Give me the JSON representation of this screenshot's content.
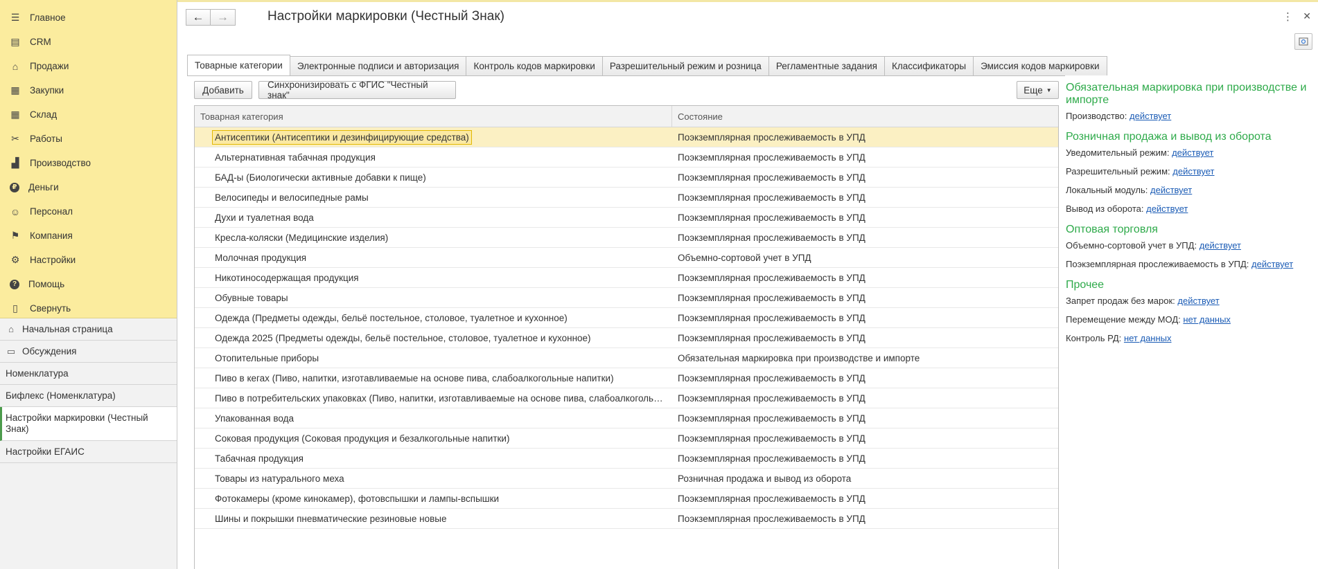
{
  "sidebar": {
    "sections": [
      {
        "label": "Главное",
        "icon": "menu-icon"
      },
      {
        "label": "CRM",
        "icon": "crm-icon"
      },
      {
        "label": "Продажи",
        "icon": "basket-icon"
      },
      {
        "label": "Закупки",
        "icon": "purchases-icon"
      },
      {
        "label": "Склад",
        "icon": "warehouse-icon"
      },
      {
        "label": "Работы",
        "icon": "tools-icon"
      },
      {
        "label": "Производство",
        "icon": "factory-icon"
      },
      {
        "label": "Деньги",
        "icon": "money-icon"
      },
      {
        "label": "Персонал",
        "icon": "staff-icon"
      },
      {
        "label": "Компания",
        "icon": "flag-icon"
      },
      {
        "label": "Настройки",
        "icon": "gear-icon"
      },
      {
        "label": "Помощь",
        "icon": "help-icon"
      },
      {
        "label": "Свернуть",
        "icon": "collapse-icon"
      }
    ],
    "open_windows": [
      {
        "label": "Начальная страница",
        "icon": "home-icon"
      },
      {
        "label": "Обсуждения",
        "icon": "chat-icon"
      },
      {
        "label": "Номенклатура"
      },
      {
        "label": "Бифлекс (Номенклатура)"
      },
      {
        "label": "Настройки маркировки (Честный Знак)"
      },
      {
        "label": "Настройки ЕГАИС"
      }
    ]
  },
  "header": {
    "title": "Настройки маркировки (Честный Знак)",
    "back_icon": "←",
    "forward_icon": "→",
    "more_icon": "⋮",
    "close_icon": "✕"
  },
  "tabs": [
    "Товарные категории",
    "Электронные подписи и авторизация",
    "Контроль кодов маркировки",
    "Разрешительный режим и розница",
    "Регламентные задания",
    "Классификаторы",
    "Эмиссия кодов маркировки"
  ],
  "toolbar": {
    "add_label": "Добавить",
    "sync_label": "Синхронизировать с ФГИС \"Честный знак\"",
    "more_label": "Еще"
  },
  "table": {
    "columns": [
      "Товарная категория",
      "Состояние"
    ],
    "rows": [
      [
        "Антисептики (Антисептики и дезинфицирующие средства)",
        "Поэкземплярная прослеживаемость в УПД"
      ],
      [
        "Альтернативная табачная продукция",
        "Поэкземплярная прослеживаемость в УПД"
      ],
      [
        "БАД-ы (Биологически активные добавки к пище)",
        "Поэкземплярная прослеживаемость в УПД"
      ],
      [
        "Велосипеды и велосипедные рамы",
        "Поэкземплярная прослеживаемость в УПД"
      ],
      [
        "Духи и туалетная вода",
        "Поэкземплярная прослеживаемость в УПД"
      ],
      [
        "Кресла-коляски (Медицинские изделия)",
        "Поэкземплярная прослеживаемость в УПД"
      ],
      [
        "Молочная продукция",
        "Объемно-сортовой учет в УПД"
      ],
      [
        "Никотиносодержащая продукция",
        "Поэкземплярная прослеживаемость в УПД"
      ],
      [
        "Обувные товары",
        "Поэкземплярная прослеживаемость в УПД"
      ],
      [
        "Одежда (Предметы одежды, бельё постельное, столовое, туалетное и кухонное)",
        "Поэкземплярная прослеживаемость в УПД"
      ],
      [
        "Одежда 2025 (Предметы одежды, бельё постельное, столовое, туалетное и кухонное)",
        "Поэкземплярная прослеживаемость в УПД"
      ],
      [
        "Отопительные приборы",
        "Обязательная маркировка при производстве и импорте"
      ],
      [
        "Пиво в кегах (Пиво, напитки, изготавливаемые на основе пива, слабоалкогольные напитки)",
        "Поэкземплярная прослеживаемость в УПД"
      ],
      [
        "Пиво в потребительских упаковках (Пиво, напитки, изготавливаемые на основе пива, слабоалкогольные ...",
        "Поэкземплярная прослеживаемость в УПД"
      ],
      [
        "Упакованная вода",
        "Поэкземплярная прослеживаемость в УПД"
      ],
      [
        "Соковая продукция (Соковая продукция и безалкогольные напитки)",
        "Поэкземплярная прослеживаемость в УПД"
      ],
      [
        "Табачная продукция",
        "Поэкземплярная прослеживаемость в УПД"
      ],
      [
        "Товары из натурального меха",
        "Розничная продажа и вывод из оборота"
      ],
      [
        "Фотокамеры (кроме кинокамер), фотовспышки и лампы-вспышки",
        "Поэкземплярная прослеживаемость в УПД"
      ],
      [
        "Шины и покрышки пневматические резиновые новые",
        "Поэкземплярная прослеживаемость в УПД"
      ]
    ]
  },
  "info": {
    "groups": [
      {
        "heading": "Обязательная маркировка при производстве и импорте",
        "lines": [
          {
            "label": "Производство:",
            "link": "действует"
          }
        ]
      },
      {
        "heading": "Розничная продажа и вывод из оборота",
        "lines": [
          {
            "label": "Уведомительный режим:",
            "link": "действует"
          },
          {
            "label": "Разрешительный режим:",
            "link": "действует"
          },
          {
            "label": "Локальный модуль:",
            "link": "действует"
          },
          {
            "label": "Вывод из оборота:",
            "link": "действует"
          }
        ]
      },
      {
        "heading": "Оптовая торговля",
        "lines": [
          {
            "label": "Объемно-сортовой учет в УПД:",
            "link": "действует"
          },
          {
            "label": "Поэкземплярная прослеживаемость в УПД:",
            "link": "действует"
          }
        ]
      },
      {
        "heading": "Прочее",
        "lines": [
          {
            "label": "Запрет продаж без марок:",
            "link": "действует"
          },
          {
            "label": "Перемещение между МОД:",
            "link": "нет данных"
          },
          {
            "label": "Контроль РД:",
            "link": "нет данных"
          }
        ]
      }
    ]
  },
  "colors": {
    "sidebar_bg": "#fbec9e",
    "heading_green": "#2eaa4a",
    "link_blue": "#1a5bb5",
    "selected_row": "#fbf0c3"
  }
}
